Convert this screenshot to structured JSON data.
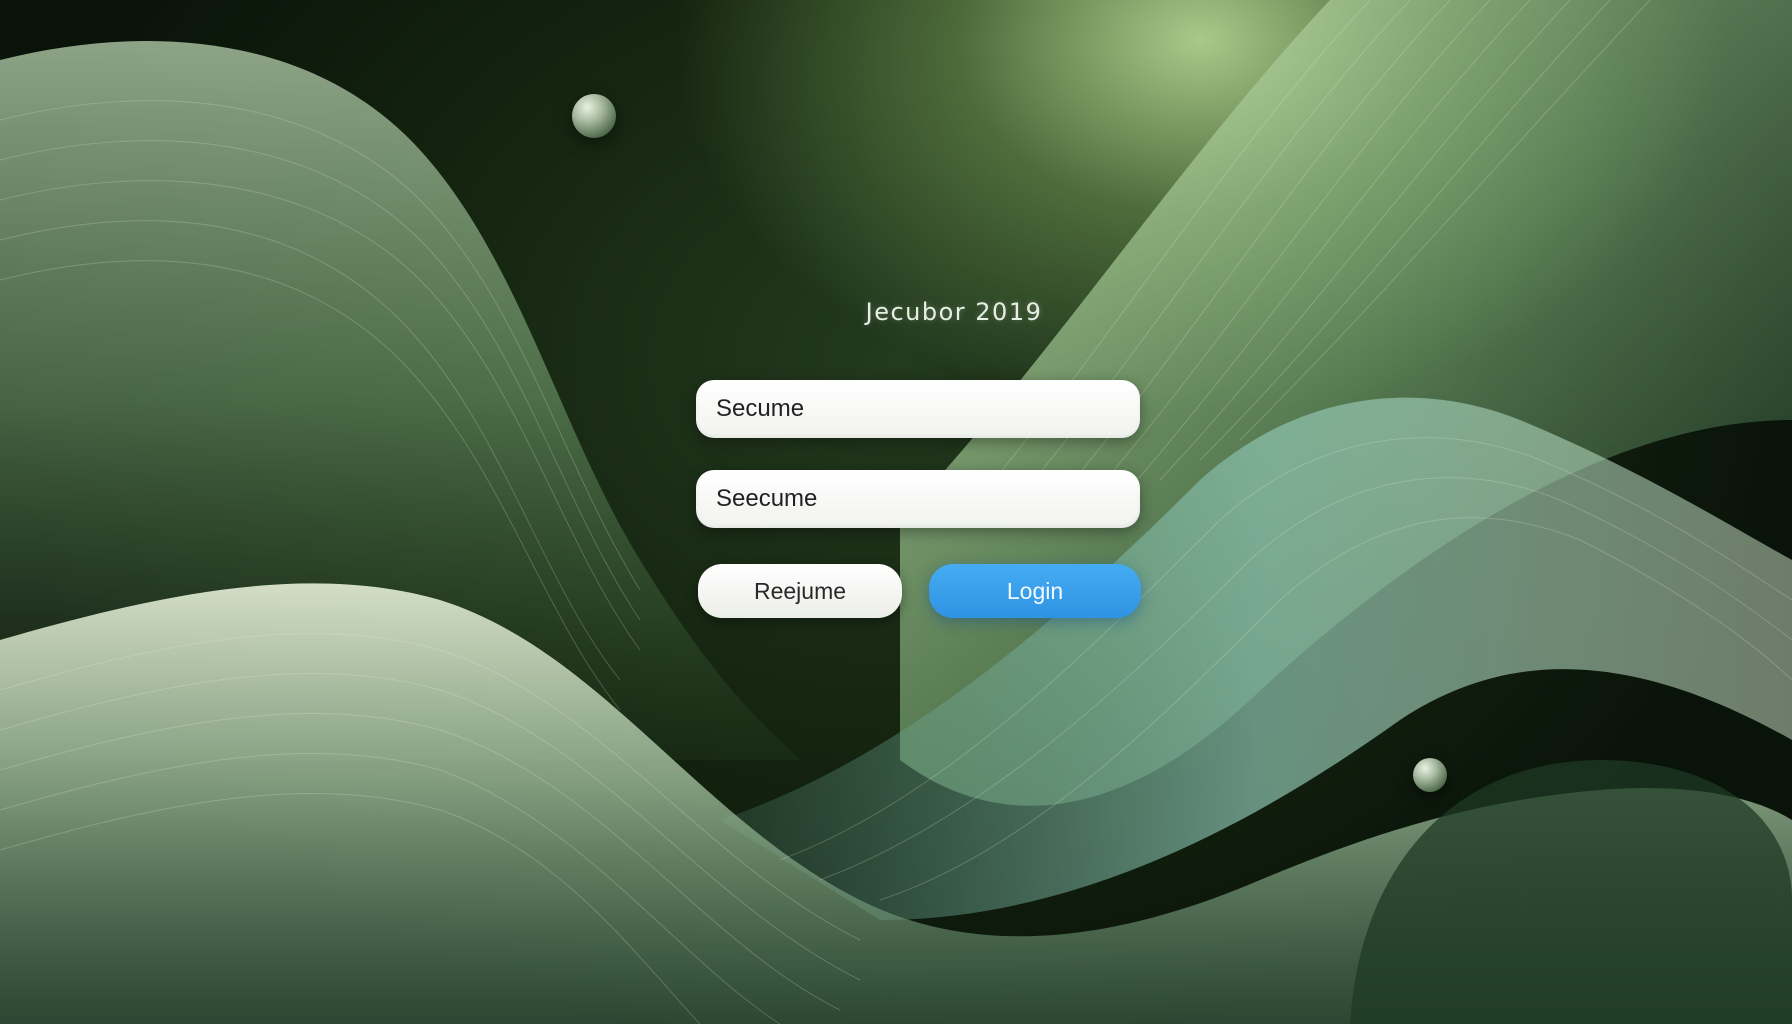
{
  "screen": {
    "title": "Jecubor 2019"
  },
  "login_form": {
    "field_1_value": "Secume",
    "field_2_value": "Seecume",
    "secondary_button_label": "Reejume",
    "login_button_label": "Login"
  },
  "colors": {
    "background_dark": "#14240f",
    "background_light": "#a9c98a",
    "primary_button": "#3aa0ee",
    "field_background": "#f6f7f4"
  }
}
